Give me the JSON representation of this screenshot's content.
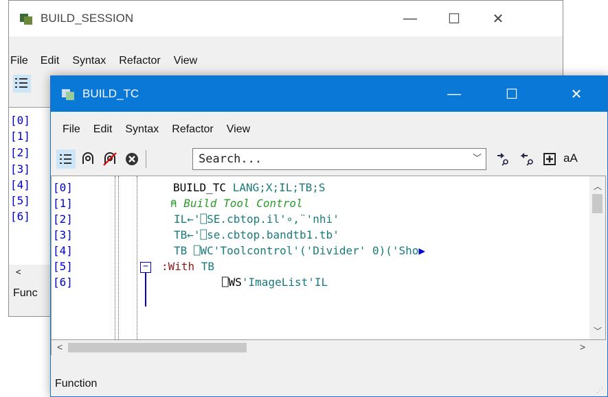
{
  "back_window": {
    "title": "BUILD_SESSION",
    "menu": [
      "File",
      "Edit",
      "Syntax",
      "Refactor",
      "View"
    ],
    "lines": [
      "[0]",
      "[1]",
      "[2]",
      "[3]",
      "[4]",
      "[5]",
      "[6]"
    ],
    "status": "Func"
  },
  "front_window": {
    "title": "BUILD_TC",
    "menu": [
      "File",
      "Edit",
      "Syntax",
      "Refactor",
      "View"
    ],
    "search_placeholder": "Search...",
    "font_toggle": "aA",
    "status": "Function",
    "line_numbers": [
      "[0]",
      "[1]",
      "[2]",
      "[3]",
      "[4]",
      "[5]",
      "[6]"
    ],
    "code": [
      {
        "a": "BUILD_TC ",
        "b": "LANG;X;IL;TB;S"
      },
      {
        "a": "⍝ ",
        "b": "Build Tool Control"
      },
      {
        "a": "IL←'",
        "b": "⎕SE.cbtop.il'∘,¨'nhi'"
      },
      {
        "a": "TB←'",
        "b": "⎕se.cbtop.bandtb1.tb'"
      },
      {
        "a": "TB ",
        "b": "⎕WC'Toolcontrol'('Divider' 0)('Sho"
      },
      {
        "a": ":With ",
        "b": "TB"
      },
      {
        "a": "⎕WS",
        "b": "'ImageList'IL"
      }
    ]
  },
  "colors": {
    "titlebar_active": "#0a78d7",
    "code_blue": "#0000cc",
    "comment_green": "#2a9a2a"
  }
}
